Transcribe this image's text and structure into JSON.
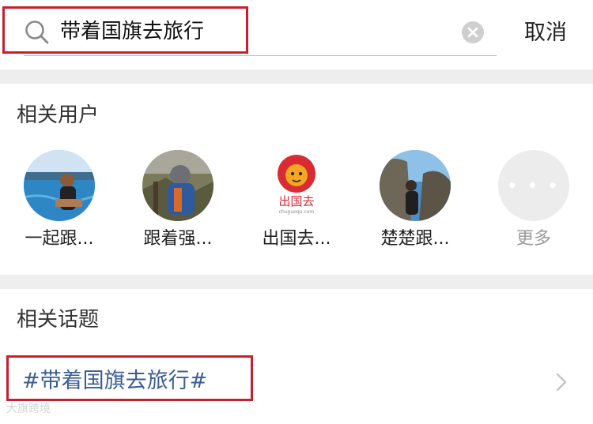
{
  "search": {
    "query": "带着国旗去旅行",
    "cancel_label": "取消"
  },
  "related_users": {
    "title": "相关用户",
    "items": [
      {
        "name": "一起跟...",
        "avatar": "avatar-beach-photo"
      },
      {
        "name": "跟着强...",
        "avatar": "avatar-hiker-photo"
      },
      {
        "name": "出国去...",
        "avatar": "avatar-lion-logo",
        "logo_text": "出国去",
        "logo_subtext": "chuguoqu.com"
      },
      {
        "name": "楚楚跟...",
        "avatar": "avatar-rock-photo"
      }
    ],
    "more_label": "更多"
  },
  "related_topics": {
    "title": "相关话题",
    "items": [
      {
        "label": "#带着国旗去旅行#"
      }
    ]
  },
  "watermark": "大旗跨境",
  "colors": {
    "highlight": "#c8202b",
    "topic_link": "#3b5e93",
    "divider": "#eeeeee"
  }
}
